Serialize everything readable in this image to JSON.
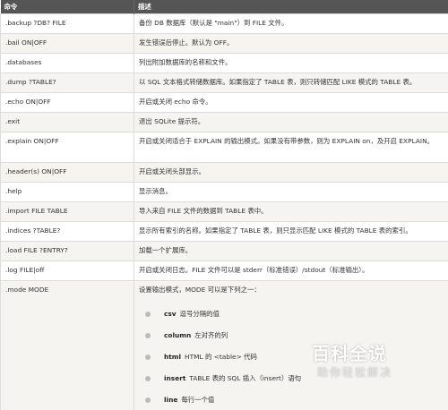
{
  "table": {
    "headers": {
      "command": "命令",
      "description": "描述"
    },
    "rows": [
      {
        "cmd": ".backup ?DB? FILE",
        "desc": "备份 DB 数据库（默认是 \"main\"）到 FILE 文件。"
      },
      {
        "cmd": ".bail ON|OFF",
        "desc": "发生错误后停止。默认为 OFF。"
      },
      {
        "cmd": ".databases",
        "desc": "列出附加数据库的名称和文件。"
      },
      {
        "cmd": ".dump ?TABLE?",
        "desc": "以 SQL 文本格式转储数据库。如果指定了 TABLE 表，则只转储匹配 LIKE 模式的 TABLE 表。"
      },
      {
        "cmd": ".echo ON|OFF",
        "desc": "开启或关闭 echo 命令。"
      },
      {
        "cmd": ".exit",
        "desc": "退出 SQLite 提示符。"
      },
      {
        "cmd": ".explain ON|OFF",
        "desc": "开启或关闭适合于 EXPLAIN 的输出模式。如果没有带参数，则为 EXPLAIN on，及开启 EXPLAIN。"
      },
      {
        "cmd": ".header(s) ON|OFF",
        "desc": "开启或关闭头部显示。"
      },
      {
        "cmd": ".help",
        "desc": "显示消息。"
      },
      {
        "cmd": ".import FILE TABLE",
        "desc": "导入来自 FILE 文件的数据到 TABLE 表中。"
      },
      {
        "cmd": ".indices ?TABLE?",
        "desc": "显示所有索引的名称。如果指定了 TABLE 表，则只显示匹配 LIKE 模式的 TABLE 表的索引。"
      },
      {
        "cmd": ".load FILE ?ENTRY?",
        "desc": "加载一个扩展库。"
      },
      {
        "cmd": ".log FILE|off",
        "desc": "开启或关闭日志。FILE 文件可以是 stderr（标准错误）/stdout（标准输出）。"
      },
      {
        "cmd": ".mode MODE",
        "desc": "设置输出模式，MODE 可以是下列之一："
      }
    ],
    "mode_options": [
      {
        "key": "csv",
        "text": "逗号分隔的值"
      },
      {
        "key": "column",
        "text": "左对齐的列"
      },
      {
        "key": "html",
        "text": "HTML 的 <table> 代码"
      },
      {
        "key": "insert",
        "text": "TABLE 表的 SQL 插入（insert）语句"
      },
      {
        "key": "line",
        "text": "每行一个值"
      }
    ]
  },
  "watermark": {
    "title": "百科全说",
    "subtitle": "助你轻松解决"
  }
}
